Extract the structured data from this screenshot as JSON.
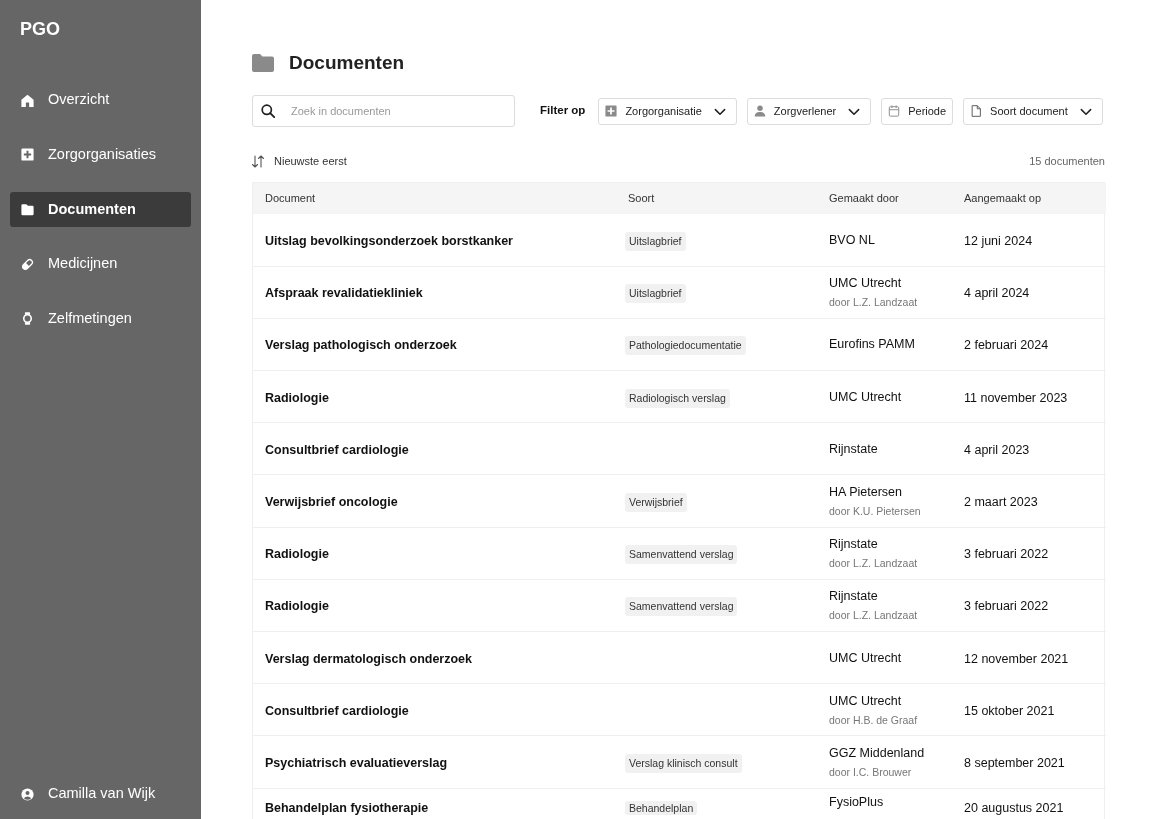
{
  "sidebar": {
    "brand": "PGO",
    "items": [
      {
        "label": "Overzicht",
        "selected": false
      },
      {
        "label": "Zorgorganisaties",
        "selected": false
      },
      {
        "label": "Documenten",
        "selected": true
      },
      {
        "label": "Medicijnen",
        "selected": false
      },
      {
        "label": "Zelfmetingen",
        "selected": false
      }
    ],
    "user": {
      "name": "Camilla van Wijk"
    }
  },
  "page": {
    "title": "Documenten"
  },
  "search": {
    "placeholder": "Zoek in documenten"
  },
  "filters": {
    "label": "Filter op",
    "buttons": [
      {
        "label": "Zorgorganisatie",
        "dropdown": true
      },
      {
        "label": "Zorgverlener",
        "dropdown": true
      },
      {
        "label": "Periode",
        "dropdown": false
      },
      {
        "label": "Soort document",
        "dropdown": true
      }
    ]
  },
  "sort": {
    "label": "Nieuwste eerst"
  },
  "count": "15 documenten",
  "table": {
    "columns": [
      "Document",
      "Soort",
      "Gemaakt door",
      "Aangemaakt op"
    ],
    "rows": [
      {
        "document": "Uitslag bevolkingsonderzoek borstkanker",
        "type": "Uitslagbrief",
        "author": "BVO NL",
        "date": "12 juni 2024"
      },
      {
        "document": "Afspraak revalidatiekliniek",
        "type": "Uitslagbrief",
        "author": "UMC Utrecht",
        "author_detail": "door L.Z. Landzaat",
        "date": "4 april 2024"
      },
      {
        "document": "Verslag pathologisch onderzoek",
        "type": "Pathologiedocumentatie",
        "author": "Eurofins PAMM",
        "date": "2 februari 2024"
      },
      {
        "document": "Radiologie",
        "type": "Radiologisch verslag",
        "author": "UMC Utrecht",
        "date": "11 november 2023"
      },
      {
        "document": "Consultbrief cardiologie",
        "author": "Rijnstate",
        "date": "4 april 2023"
      },
      {
        "document": "Verwijsbrief oncologie",
        "type": "Verwijsbrief",
        "author": "HA Pietersen",
        "author_detail": "door K.U. Pietersen",
        "date": "2 maart 2023"
      },
      {
        "document": "Radiologie",
        "type": "Samenvattend verslag",
        "author": "Rijnstate",
        "author_detail": "door L.Z. Landzaat",
        "date": "3 februari 2022"
      },
      {
        "document": "Radiologie",
        "type": "Samenvattend verslag",
        "author": "Rijnstate",
        "author_detail": "door L.Z. Landzaat",
        "date": "3 februari 2022"
      },
      {
        "document": "Verslag dermatologisch onderzoek",
        "author": "UMC Utrecht",
        "date": "12 november 2021"
      },
      {
        "document": "Consultbrief cardiologie",
        "author": "UMC Utrecht",
        "author_detail": "door H.B. de Graaf",
        "date": "15 oktober 2021"
      },
      {
        "document": "Psychiatrisch evaluatieverslag",
        "type": "Verslag klinisch consult",
        "author": "GGZ Middenland",
        "author_detail": "door I.C. Brouwer",
        "date": "8 september 2021"
      },
      {
        "document": "Behandelplan fysiotherapie",
        "type": "Behandelplan",
        "author": "FysioPlus",
        "date": "20 augustus 2021"
      }
    ]
  }
}
